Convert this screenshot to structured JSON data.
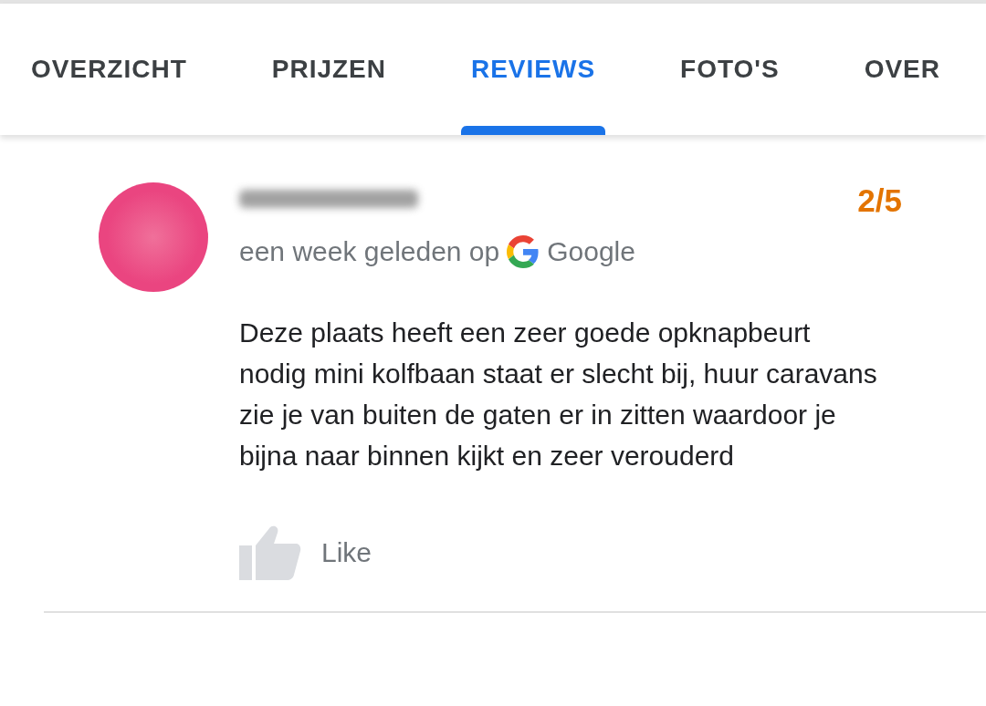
{
  "tabs": [
    {
      "label": "OVERZICHT",
      "selected": false
    },
    {
      "label": "PRIJZEN",
      "selected": false
    },
    {
      "label": "REVIEWS",
      "selected": true
    },
    {
      "label": "FOTO'S",
      "selected": false
    },
    {
      "label": "OVER",
      "selected": false
    }
  ],
  "review": {
    "rating": "2/5",
    "time": "een week geleden op",
    "source": "Google",
    "text": "Deze plaats heeft een zeer goede opknapbeurt nodig mini kolfbaan staat er slecht bij, huur caravans zie je van buiten de gaten er in zitten waardoor je bijna naar binnen kijkt en zeer verouderd",
    "like": "Like"
  }
}
